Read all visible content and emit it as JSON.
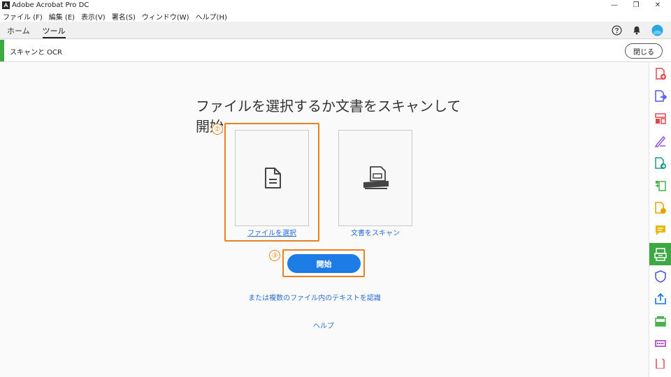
{
  "window": {
    "title": "Adobe Acrobat Pro DC",
    "minimize": "—",
    "restore": "❐",
    "close": "✕"
  },
  "menu": [
    "ファイル (F)",
    "編集 (E)",
    "表示(V)",
    "署名(S)",
    "ウィンドウ(W)",
    "ヘルプ(H)"
  ],
  "nav": {
    "tabs": [
      {
        "label": "ホーム",
        "active": false
      },
      {
        "label": "ツール",
        "active": true
      }
    ],
    "help_icon": "?"
  },
  "tool": {
    "name": "スキャンと OCR",
    "close_label": "閉じる",
    "accent_color": "#3ea845"
  },
  "main": {
    "heading": "ファイルを選択するか文書をスキャンして開始",
    "options": [
      {
        "label": "ファイルを選択",
        "icon": "document-icon"
      },
      {
        "label": "文書をスキャン",
        "icon": "scanner-icon"
      }
    ],
    "start_label": "開始",
    "multi_file_link": "または複数のファイル内のテキストを認識",
    "help_link": "ヘルプ"
  },
  "annotations": {
    "step2": "②",
    "step3": "③",
    "color": "#e8821e"
  },
  "rightbar_icons": [
    "create-pdf-icon",
    "export-pdf-icon",
    "organize-pages-icon",
    "fill-sign-icon",
    "send-for-signature-icon",
    "compress-icon",
    "edit-pdf-icon",
    "comment-icon",
    "scan-ocr-icon",
    "protect-icon",
    "share-icon",
    "stamp-icon",
    "redact-icon",
    "more-tools-icon"
  ]
}
